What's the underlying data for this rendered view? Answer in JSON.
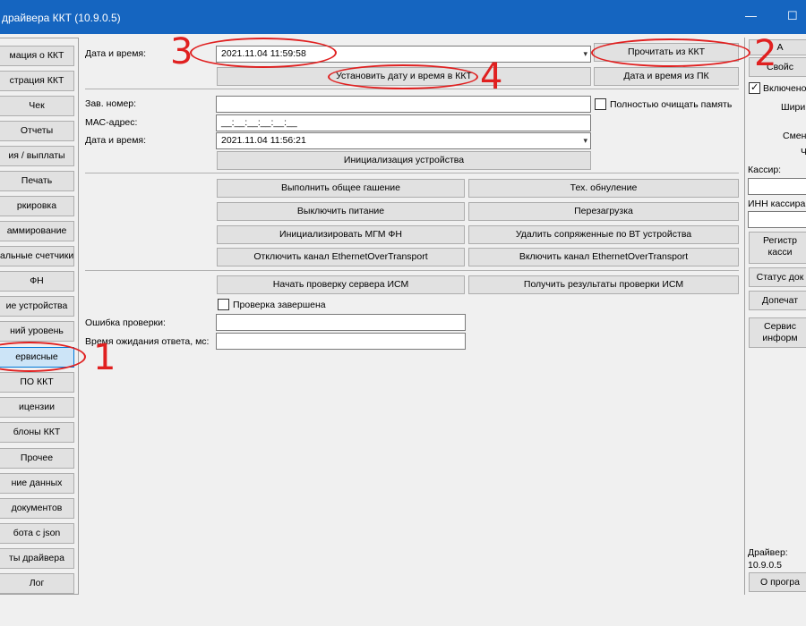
{
  "window": {
    "title": "драйвера ККТ (10.9.0.5)",
    "minimize": "—",
    "maximize": "☐"
  },
  "sidebar": {
    "items": [
      {
        "label": "мация о ККТ"
      },
      {
        "label": "страция ККТ"
      },
      {
        "label": "Чек"
      },
      {
        "label": "Отчеты"
      },
      {
        "label": "ия / выплаты"
      },
      {
        "label": "Печать"
      },
      {
        "label": "ркировка"
      },
      {
        "label": "аммирование"
      },
      {
        "label": "альные счетчики"
      },
      {
        "label": "ФН"
      },
      {
        "label": "ие устройства"
      },
      {
        "label": "ний уровень"
      },
      {
        "label": "ервисные",
        "active": true
      },
      {
        "label": "ПО ККТ"
      },
      {
        "label": "ицензии"
      },
      {
        "label": "блоны ККТ"
      },
      {
        "label": "Прочее"
      },
      {
        "label": "ние данных"
      },
      {
        "label": "документов"
      },
      {
        "label": "бота с json"
      },
      {
        "label": "ты драйвера"
      },
      {
        "label": "Лог"
      }
    ]
  },
  "main": {
    "datetime_label": "Дата и время:",
    "datetime_value": "2021.11.04 11:59:58",
    "read_button": "Прочитать из ККТ",
    "set_datetime_button": "Установить дату и время в ККТ",
    "pc_datetime_button": "Дата и время из ПК",
    "serial_label": "Зав. номер:",
    "serial_value": "",
    "clear_memory_label": "Полностью очищать память",
    "mac_label": "МАС-адрес:",
    "mac_value": "__:__:__:__:__:__",
    "datetime2_label": "Дата и время:",
    "datetime2_value": "2021.11.04 11:56:21",
    "init_device_button": "Инициализация устройства",
    "grid_buttons": [
      [
        "Выполнить общее гашение",
        "Тех. обнуление"
      ],
      [
        "Выключить питание",
        "Перезагрузка"
      ],
      [
        "Инициализировать МГМ ФН",
        "Удалить сопряженные по ВТ устройства"
      ],
      [
        "Отключить канал EthernetOverTransport",
        "Включить канал EthernetOverTransport"
      ]
    ],
    "ism_start_button": "Начать проверку сервера ИСМ",
    "ism_results_button": "Получить результаты проверки ИСМ",
    "check_done_label": "Проверка завершена",
    "check_error_label": "Ошибка проверки:",
    "check_error_value": "",
    "timeout_label": "Время ожидания ответа, мс:",
    "timeout_value": ""
  },
  "right": {
    "top_btn": "А",
    "props_btn": "Свойс",
    "enabled_label": "Включено",
    "width_label": "Шири",
    "shift_label": "Смен",
    "ch_label": "Ч",
    "cashier_label": "Кассир:",
    "cashier_inn_label": "ИНН кассира:",
    "register_btn_line1": "Регистр",
    "register_btn_line2": "касси",
    "doc_status_btn": "Статус док",
    "reprint_btn": "Допечат",
    "service_btn_line1": "Сервис",
    "service_btn_line2": "информ",
    "driver_label": "Драйвер:",
    "driver_version": "10.9.0.5",
    "about_btn": "О програ"
  },
  "annotations": [
    "1",
    "2",
    "3",
    "4"
  ],
  "colors": {
    "titlebar": "#1565c0",
    "annotation": "#e02020",
    "active_nav": "#cce4f7"
  }
}
